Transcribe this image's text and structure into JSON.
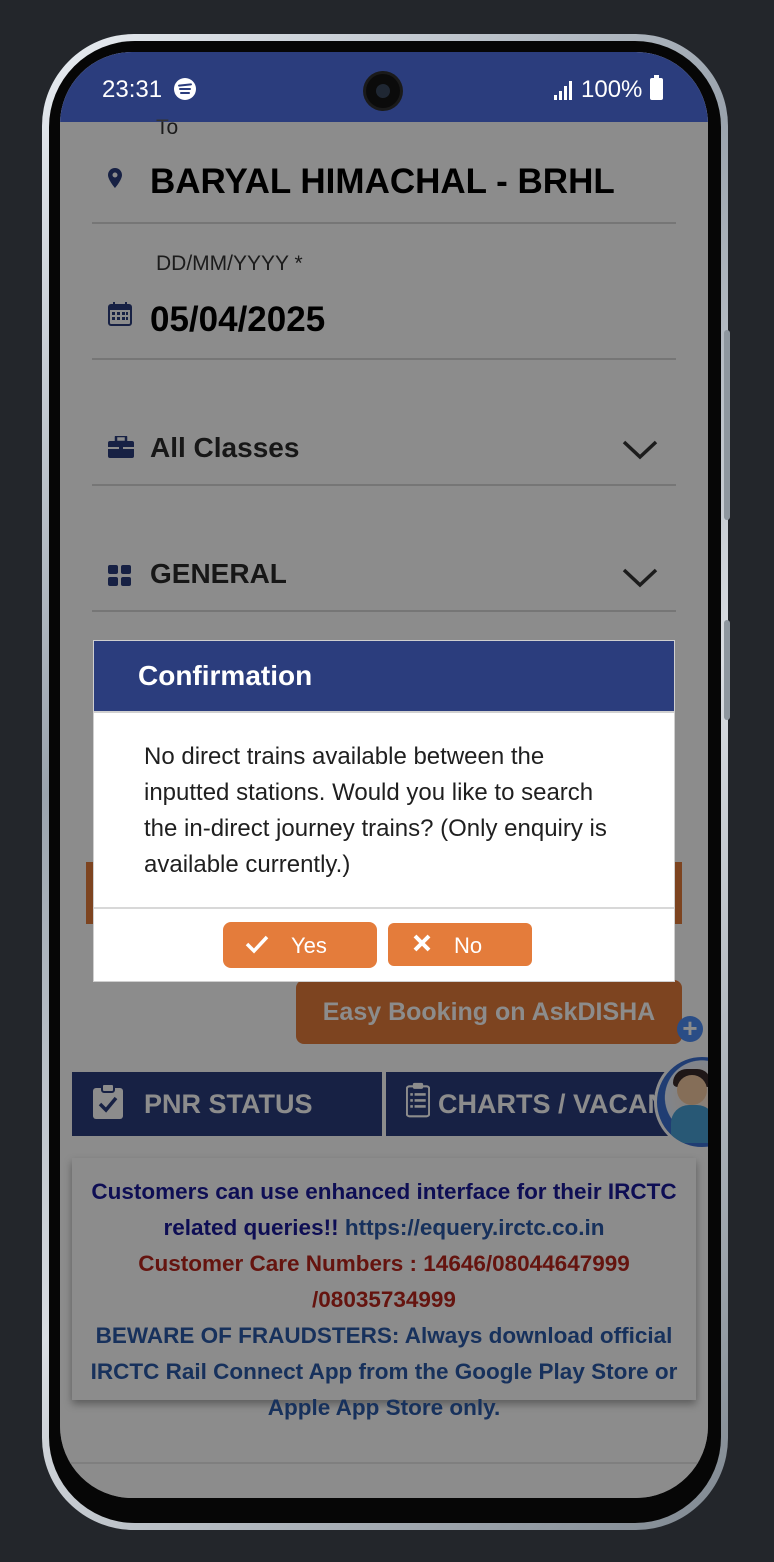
{
  "status_bar": {
    "time": "23:31",
    "battery": "100%"
  },
  "form": {
    "to_label": "To",
    "to_station": "BARYAL HIMACHAL - BRHL",
    "date_label": "DD/MM/YYYY *",
    "date_value": "05/04/2025",
    "class_selected": "All Classes",
    "quota_selected": "GENERAL"
  },
  "buttons": {
    "easy_booking": "Easy Booking on AskDISHA",
    "pnr_status": "PNR STATUS",
    "charts_vacancy": "CHARTS / VACANCY"
  },
  "notice": {
    "line1": "Customers can use enhanced interface for their IRCTC related queries!!",
    "link": "https://equery.irctc.co.in",
    "care": "Customer Care Numbers : 14646/08044647999 /08035734999",
    "warning": "BEWARE OF FRAUDSTERS: Always download official IRCTC Rail Connect App from the Google Play Store or Apple App Store only."
  },
  "dialog": {
    "title": "Confirmation",
    "message": "No direct trains available between the inputted stations. Would you like to search the in-direct journey trains? (Only enquiry is available currently.)",
    "yes_label": "Yes",
    "no_label": "No"
  },
  "icons": {
    "status": [
      "spotify-icon",
      "camera-icon",
      "signal-icon",
      "battery-icon"
    ],
    "form": [
      "location-pin-icon",
      "calendar-icon",
      "briefcase-icon",
      "grid-icon",
      "chevron-down-icon"
    ],
    "actions": [
      "plus-icon",
      "clipboard-check-icon",
      "clipboard-list-icon",
      "askdisha-avatar-icon",
      "check-icon",
      "close-icon"
    ]
  },
  "colors": {
    "brand_navy": "#2b3d7d",
    "accent_orange": "#e47c3b",
    "notice_blue": "#1a1a9a",
    "notice_link": "#2a5aa8",
    "notice_red": "#b8261c"
  }
}
